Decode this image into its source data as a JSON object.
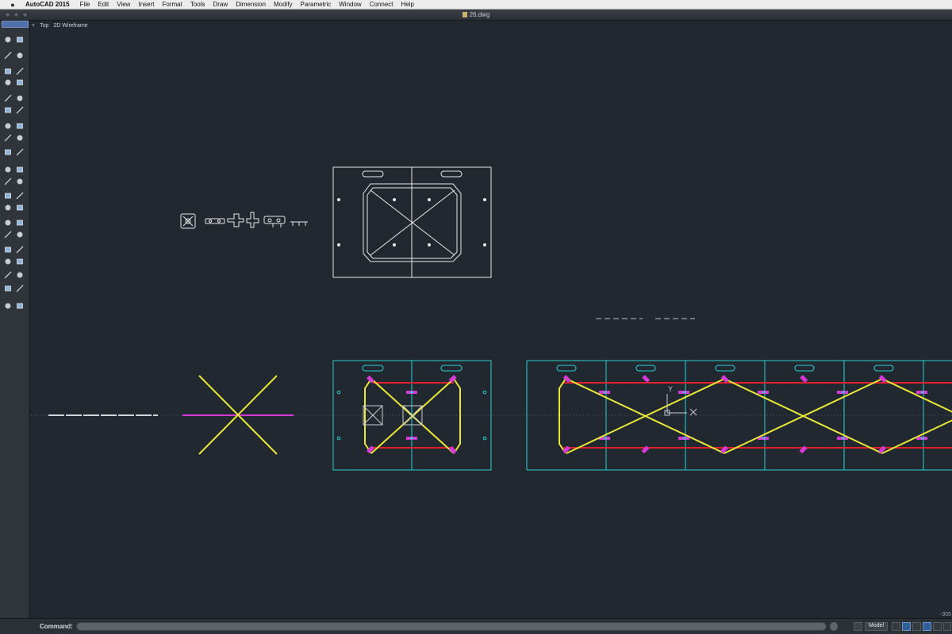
{
  "menubar": {
    "app_name": "AutoCAD 2015",
    "menus": [
      "File",
      "Edit",
      "View",
      "Insert",
      "Format",
      "Tools",
      "Draw",
      "Dimension",
      "Modify",
      "Parametric",
      "Window",
      "Connect",
      "Help"
    ]
  },
  "window": {
    "document_title": "26.dwg"
  },
  "viewport": {
    "plus": "+",
    "view_name": "Top",
    "visual_style": "2D Wireframe"
  },
  "ucs": {
    "y_label": "Y",
    "x_label": "X"
  },
  "command": {
    "label": "Command:",
    "value": ""
  },
  "status": {
    "space": "Model",
    "coordinate": "-305"
  },
  "palette": {
    "tool_icons": [
      "crosshair-icon",
      "layers-icon",
      "undo-icon",
      "redo-icon",
      "line-icon",
      "arc-icon",
      "polyline-icon",
      "spline-icon",
      "circle-icon",
      "rectangle-icon",
      "ellipse-icon",
      "polygon-icon",
      "extrude-icon",
      "box-icon",
      "fillet-icon",
      "eraser-icon",
      "move-icon",
      "rotate-icon",
      "scale-icon",
      "mirror-icon",
      "array-icon",
      "stretch-icon",
      "text-icon",
      "dimension-icon",
      "hatch-icon",
      "trim-icon"
    ]
  },
  "colors": {
    "background": "#212830",
    "white_lines": "#e6e9ec",
    "cyan": "#2ad1d6",
    "yellow": "#e8e83a",
    "red": "#e0202a",
    "magenta": "#d63ad6"
  }
}
